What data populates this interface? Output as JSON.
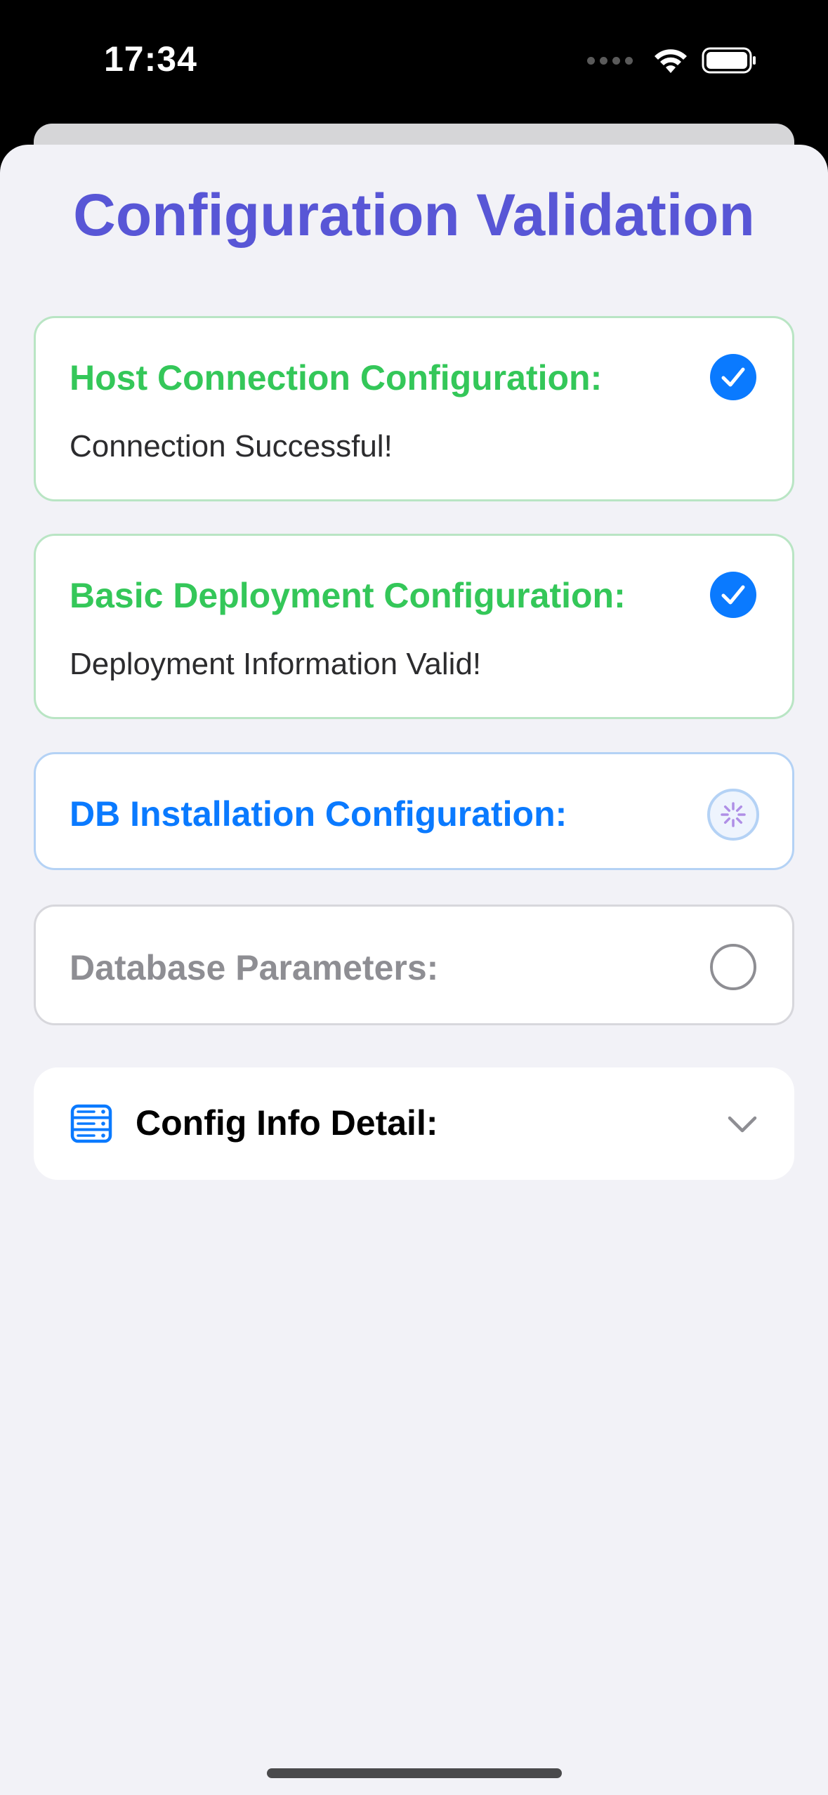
{
  "status_bar": {
    "time": "17:34",
    "icons": [
      "cellular-signal-icon",
      "wifi-icon",
      "battery-icon"
    ]
  },
  "page": {
    "title": "Configuration Validation"
  },
  "checks": [
    {
      "title": "Host Connection Configuration:",
      "message": "Connection Successful!",
      "state": "success",
      "icon": "checkmark-circle-icon"
    },
    {
      "title": "Basic Deployment Configuration:",
      "message": "Deployment Information Valid!",
      "state": "success",
      "icon": "checkmark-circle-icon"
    },
    {
      "title": "DB Installation Configuration:",
      "message": "",
      "state": "in-progress",
      "icon": "spinner-icon"
    },
    {
      "title": "Database Parameters:",
      "message": "",
      "state": "pending",
      "icon": "empty-circle-icon"
    }
  ],
  "detail": {
    "label": "Config Info Detail:",
    "icon": "server-rack-icon",
    "expanded": false
  },
  "colors": {
    "title": "#5856d6",
    "success": "#34c759",
    "progress": "#0a7aff",
    "pending": "#8e8e93",
    "background": "#f2f2f7"
  }
}
